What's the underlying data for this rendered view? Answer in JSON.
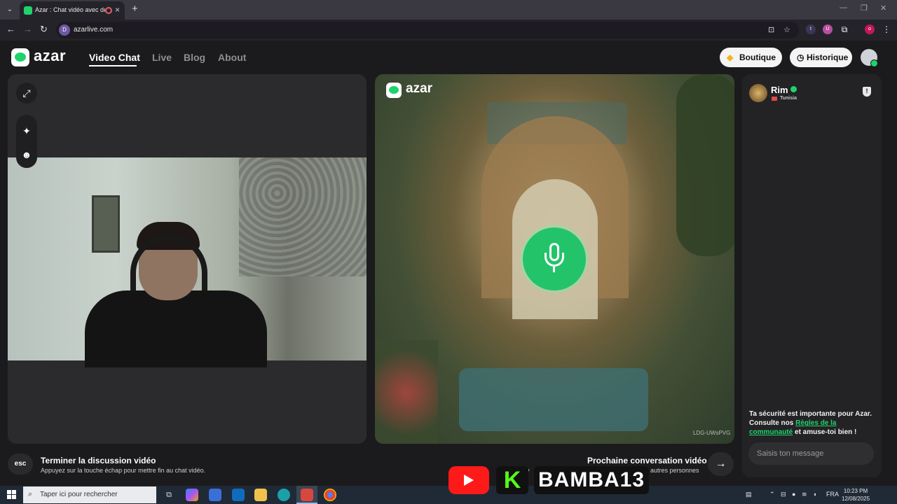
{
  "browser": {
    "tab_title": "Azar : Chat vidéo avec de n",
    "url": "azarlive.com",
    "site_chip": "D"
  },
  "header": {
    "logo_text": "azar",
    "nav": [
      "Video Chat",
      "Live",
      "Blog",
      "About"
    ],
    "boutique_label": "Boutique",
    "historique_label": "Historique"
  },
  "center": {
    "watermark": "azar",
    "peer_id": "LDG-UWsPVG"
  },
  "peer": {
    "name": "Rim",
    "country": "Tunisia"
  },
  "chat": {
    "safety_prefix": "Ta sécurité est importante pour Azar. Consulte nos ",
    "safety_link": "Règles de la communauté",
    "safety_suffix": " et amuse-toi bien !",
    "input_placeholder": "Saisis ton message"
  },
  "bottom": {
    "esc_label": "esc",
    "end_title": "Terminer la discussion vidéo",
    "end_sub": "Appuyez sur la touche échap pour mettre fin au chat vidéo.",
    "next_title": "Prochaine conversation vidéo",
    "next_sub": "autres personnes",
    "next_sub_fragment": "y"
  },
  "overlay": {
    "kick_letter": "K",
    "handle": "BAMBA13"
  },
  "taskbar": {
    "search_placeholder": "Taper ici pour rechercher",
    "lang": "FRA",
    "time": "10:23 PM",
    "date": "12/08/2025"
  },
  "colors": {
    "accent_green": "#1ed36d",
    "page_bg": "#1b1b1d",
    "youtube_red": "#ff1a1a",
    "kick_green": "#53fc18"
  }
}
